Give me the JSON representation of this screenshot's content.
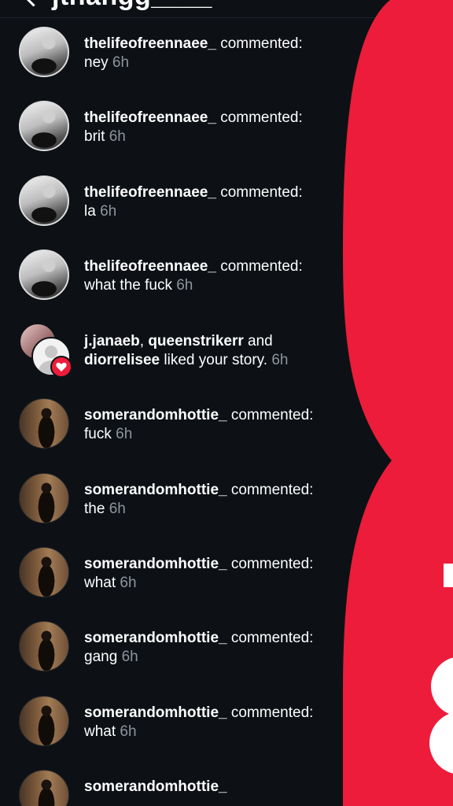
{
  "header": {
    "title": "jthangg____"
  },
  "notifications": [
    {
      "username": "thelifeofreennaee_",
      "action": "commented:",
      "text": "ney",
      "time": "6h",
      "avatar": "bw"
    },
    {
      "username": "thelifeofreennaee_",
      "action": "commented:",
      "text": "brit",
      "time": "6h",
      "avatar": "bw"
    },
    {
      "username": "thelifeofreennaee_",
      "action": "commented:",
      "text": "la",
      "time": "6h",
      "avatar": "bw"
    },
    {
      "username": "thelifeofreennaee_",
      "action": "commented:",
      "text": "what the fuck",
      "time": "6h",
      "avatar": "bw"
    },
    {
      "users": [
        "j.janaeb",
        "queenstrikerr",
        "diorrelisee"
      ],
      "separator": ", ",
      "and": "and",
      "action": "liked your story.",
      "time": "6h",
      "type": "like"
    },
    {
      "username": "somerandomhottie_",
      "action": "commented:",
      "text": "fuck",
      "time": "6h",
      "avatar": "dark"
    },
    {
      "username": "somerandomhottie_",
      "action": "commented:",
      "text": "the",
      "time": "6h",
      "avatar": "dark"
    },
    {
      "username": "somerandomhottie_",
      "action": "commented:",
      "text": "what",
      "time": "6h",
      "avatar": "dark"
    },
    {
      "username": "somerandomhottie_",
      "action": "commented:",
      "text": "gang",
      "time": "6h",
      "avatar": "dark"
    },
    {
      "username": "somerandomhottie_",
      "action": "commented:",
      "text": "what",
      "time": "6h",
      "avatar": "dark"
    },
    {
      "username": "somerandomhottie_",
      "avatar": "dark"
    }
  ],
  "colors": {
    "background": "#0d1116",
    "accent_red": "#ed1c3a",
    "muted": "#8e949b"
  }
}
